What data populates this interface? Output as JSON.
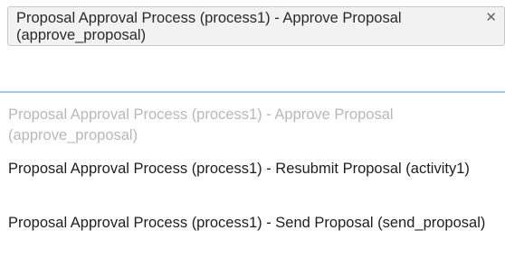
{
  "selected": {
    "label": "Proposal Approval Process (process1) - Approve Proposal (approve_proposal)",
    "remove_glyph": "✕",
    "remove_icon": "close-icon"
  },
  "options": [
    {
      "label": "Proposal Approval Process (process1) - Approve Proposal (approve_proposal)",
      "state": "selected"
    },
    {
      "label": "Proposal Approval Process (process1) - Resubmit Proposal (activity1)",
      "state": "available"
    },
    {
      "label": "Proposal Approval Process (process1) - Send Proposal (send_proposal)",
      "state": "available"
    }
  ],
  "colors": {
    "divider": "#a8c4e8",
    "selected_option_text": "#b8b8b8",
    "tag_background": "#f2f2f2"
  }
}
